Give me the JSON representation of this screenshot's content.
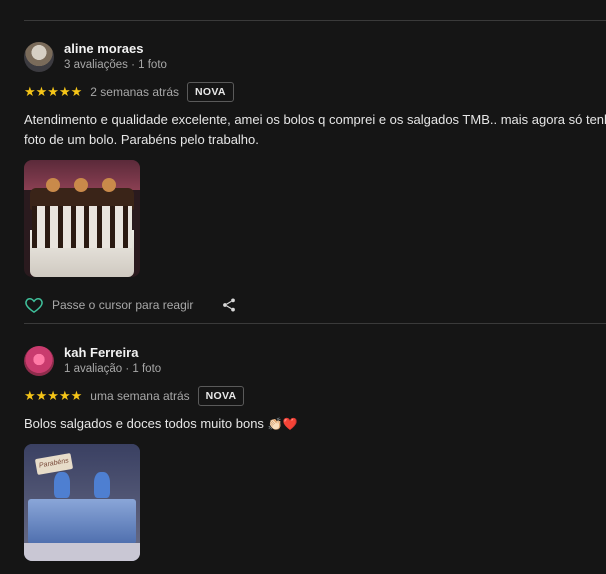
{
  "reviews": [
    {
      "author": "aline moraes",
      "meta": "3 avaliações · 1 foto",
      "stars": 5,
      "stars_text": "★★★★★",
      "when": "2 semanas atrás",
      "badge": "NOVA",
      "text_line1": "Atendimento e qualidade excelente, amei os bolos q comprei e os salgados TMB.. mais agora só tenho",
      "text_line2": "foto de um bolo. Parabéns pelo trabalho.",
      "react_label": "Passe o cursor para reagir"
    },
    {
      "author": "kah Ferreira",
      "meta": "1 avaliação · 1 foto",
      "stars": 5,
      "stars_text": "★★★★★",
      "when": "uma semana atrás",
      "badge": "NOVA",
      "text_line1": "Bolos salgados e doces todos muito bons",
      "emoji": "👏🏻❤️",
      "photo_sign": "Parabéns"
    }
  ],
  "icons": {
    "heart": "heart-outline-icon",
    "share": "share-icon"
  },
  "colors": {
    "background": "#151515",
    "star": "#f5c518",
    "heart": "#3fbf9a"
  }
}
